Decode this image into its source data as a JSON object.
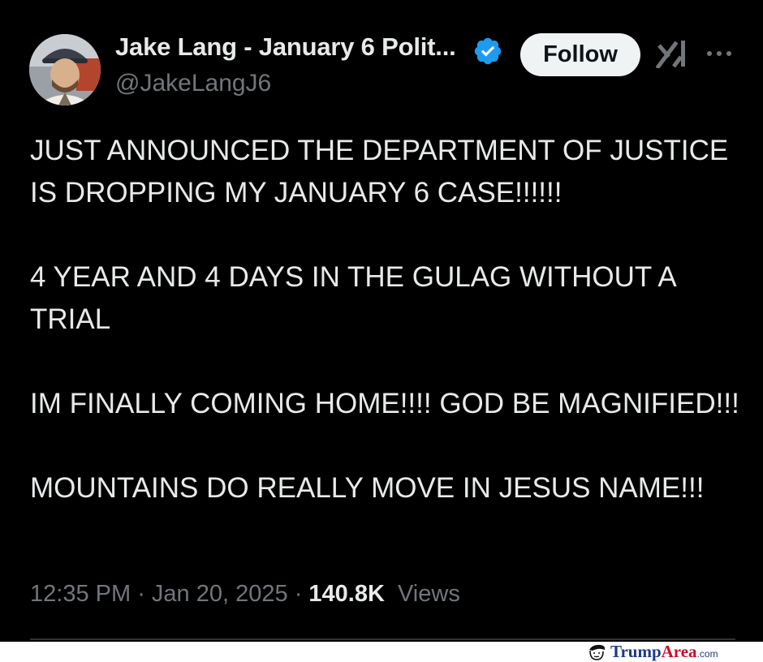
{
  "author": {
    "name": "Jake Lang - January 6 Polit...",
    "handle": "@JakeLangJ6",
    "verified": true,
    "avatar_icon": "profile-photo"
  },
  "actions": {
    "follow_label": "Follow",
    "grok_icon": "grok-icon",
    "more_icon": "more-horizontal-icon"
  },
  "post": {
    "paragraphs": [
      "JUST ANNOUNCED THE DEPARTMENT OF JUSTICE IS DROPPING MY JANUARY 6 CASE!!!!!!",
      "4 YEAR AND 4 DAYS IN THE GULAG WITHOUT A TRIAL",
      "IM FINALLY COMING HOME!!!! GOD BE MAGNIFIED!!!",
      "MOUNTAINS DO REALLY MOVE IN JESUS NAME!!!"
    ]
  },
  "meta": {
    "time": "12:35 PM",
    "date": "Jan 20, 2025",
    "views_count": "140.8K",
    "views_label": "Views",
    "separator": "·"
  },
  "watermark": {
    "text_main": "Trump",
    "text_accent": "Area",
    "text_suffix": ".com"
  },
  "colors": {
    "background": "#000000",
    "text_primary": "#e7e9ea",
    "text_secondary": "#71767b",
    "verified_blue": "#1d9bf0",
    "follow_bg": "#eff3f4"
  }
}
